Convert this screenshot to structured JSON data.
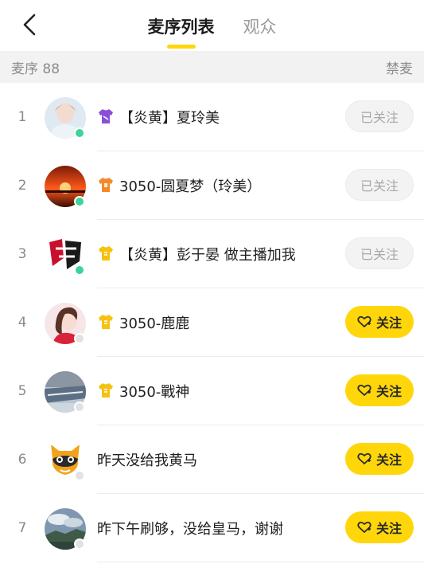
{
  "header": {
    "back_icon": "chevron-left-icon",
    "tabs": [
      {
        "label": "麦序列表",
        "active": true
      },
      {
        "label": "观众",
        "active": false
      }
    ]
  },
  "subbar": {
    "mic_count_label": "麦序 88",
    "mute_label": "禁麦"
  },
  "colors": {
    "accent": "#ffd60a",
    "online": "#3fd39a",
    "badge_purple": "#8a4fd8",
    "badge_orange": "#f5892a",
    "badge_yellow": "#f5c211"
  },
  "rows": [
    {
      "index": "1",
      "name": "【炎黄】夏玲美",
      "badge": "shirt-purple-icon",
      "status": "online",
      "follow_label": "已关注",
      "followed": true
    },
    {
      "index": "2",
      "name": "3050-圆夏梦（玲美）",
      "badge": "shirt-orange-icon",
      "status": "online",
      "follow_label": "已关注",
      "followed": true
    },
    {
      "index": "3",
      "name": "【炎黄】彭于晏 做主播加我",
      "badge": "shirt-yellow-icon",
      "status": "online",
      "follow_label": "已关注",
      "followed": true
    },
    {
      "index": "4",
      "name": "3050-鹿鹿",
      "badge": "shirt-yellow-icon",
      "status": "offline",
      "follow_label": "关注",
      "followed": false
    },
    {
      "index": "5",
      "name": "3050-戰神",
      "badge": "shirt-yellow-icon",
      "status": "offline",
      "follow_label": "关注",
      "followed": false
    },
    {
      "index": "6",
      "name": "昨天没给我黄马",
      "badge": "",
      "status": "offline",
      "follow_label": "关注",
      "followed": false
    },
    {
      "index": "7",
      "name": "昨下午刷够，没给皇马，谢谢",
      "badge": "",
      "status": "offline",
      "follow_label": "关注",
      "followed": false
    }
  ]
}
